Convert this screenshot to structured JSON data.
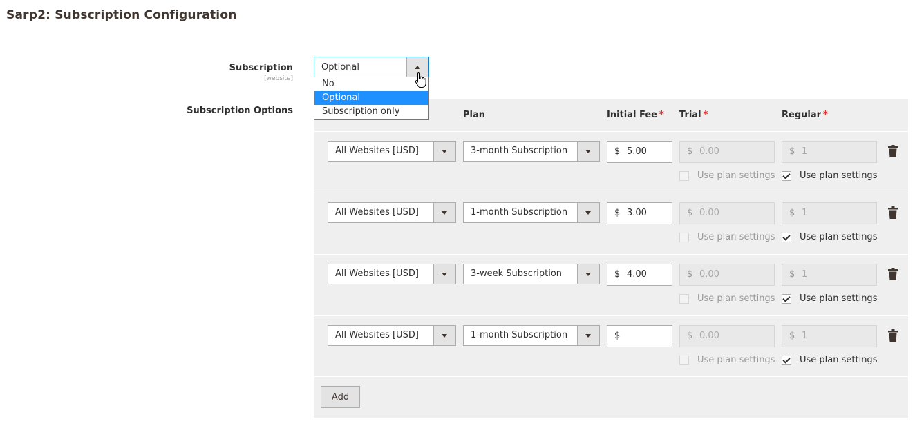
{
  "page_title": "Sarp2: Subscription Configuration",
  "subscription": {
    "label": "Subscription",
    "scope": "[website]",
    "selected": "Optional",
    "options": [
      "No",
      "Optional",
      "Subscription only"
    ],
    "highlighted_index": 1
  },
  "subscription_options": {
    "label": "Subscription Options",
    "columns": {
      "plan": "Plan",
      "initial_fee": "Initial Fee",
      "trial": "Trial",
      "regular": "Regular",
      "required_mark": "*"
    },
    "currency_symbol": "$",
    "use_plan_settings_label": "Use plan settings",
    "rows": [
      {
        "website": "All Websites [USD]",
        "plan": "3-month Subscription",
        "initial_fee": "5.00",
        "trial": "0.00",
        "regular": "1",
        "trial_use_plan": false,
        "regular_use_plan": true
      },
      {
        "website": "All Websites [USD]",
        "plan": "1-month Subscription",
        "initial_fee": "3.00",
        "trial": "0.00",
        "regular": "1",
        "trial_use_plan": false,
        "regular_use_plan": true
      },
      {
        "website": "All Websites [USD]",
        "plan": "3-week Subscription",
        "initial_fee": "4.00",
        "trial": "0.00",
        "regular": "1",
        "trial_use_plan": false,
        "regular_use_plan": true
      },
      {
        "website": "All Websites [USD]",
        "plan": "1-month Subscription",
        "initial_fee": "",
        "trial": "0.00",
        "regular": "1",
        "trial_use_plan": false,
        "regular_use_plan": true
      }
    ],
    "add_label": "Add"
  },
  "icons": {
    "delete": "trash-icon",
    "cursor": "hand-pointer-icon",
    "dropdown": "chevron-down-icon"
  },
  "colors": {
    "highlight": "#1e90ff",
    "focus_border": "#1979c3",
    "required": "#e22626",
    "panel_bg": "#efefef"
  }
}
